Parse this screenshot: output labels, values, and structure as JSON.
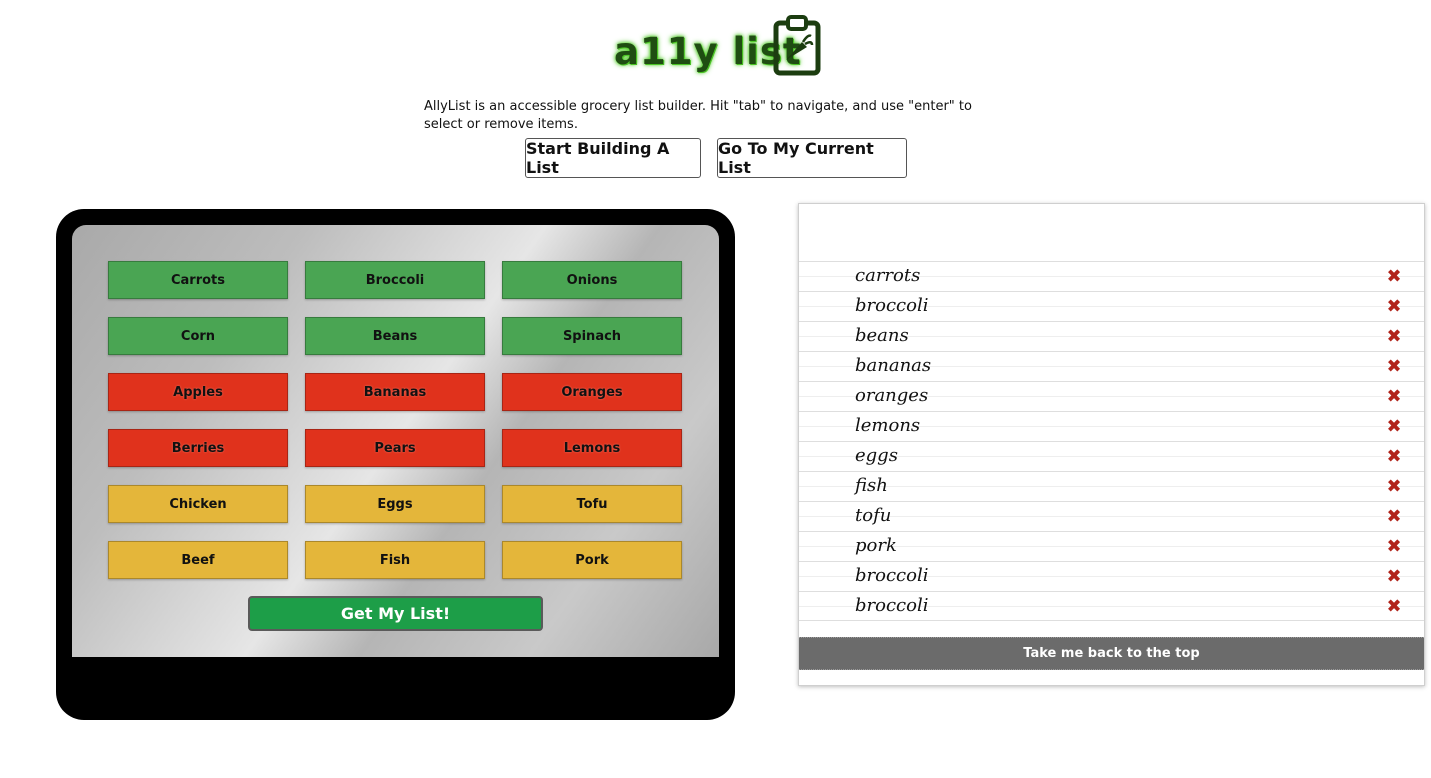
{
  "header": {
    "logo_text": "a11y list",
    "logo_icon": "clipboard-carrot-icon",
    "intro": "AllyList is an accessible grocery list builder. Hit \"tab\" to navigate, and use \"enter\" to select or remove items.",
    "start_label": "Start Building A List",
    "current_label": "Go To My Current List"
  },
  "builder": {
    "rows": [
      [
        {
          "label": "Carrots",
          "group": "veg"
        },
        {
          "label": "Broccoli",
          "group": "veg"
        },
        {
          "label": "Onions",
          "group": "veg"
        }
      ],
      [
        {
          "label": "Corn",
          "group": "veg"
        },
        {
          "label": "Beans",
          "group": "veg"
        },
        {
          "label": "Spinach",
          "group": "veg"
        }
      ],
      [
        {
          "label": "Apples",
          "group": "fruit"
        },
        {
          "label": "Bananas",
          "group": "fruit"
        },
        {
          "label": "Oranges",
          "group": "fruit"
        }
      ],
      [
        {
          "label": "Berries",
          "group": "fruit"
        },
        {
          "label": "Pears",
          "group": "fruit"
        },
        {
          "label": "Lemons",
          "group": "fruit"
        }
      ],
      [
        {
          "label": "Chicken",
          "group": "protein"
        },
        {
          "label": "Eggs",
          "group": "protein"
        },
        {
          "label": "Tofu",
          "group": "protein"
        }
      ],
      [
        {
          "label": "Beef",
          "group": "protein"
        },
        {
          "label": "Fish",
          "group": "protein"
        },
        {
          "label": "Pork",
          "group": "protein"
        }
      ]
    ],
    "get_list_label": "Get My List!"
  },
  "list": {
    "items": [
      "carrots",
      "broccoli",
      "beans",
      "bananas",
      "oranges",
      "lemons",
      "eggs",
      "fish",
      "tofu",
      "pork",
      "broccoli",
      "broccoli"
    ],
    "remove_icon": "close-x-icon",
    "back_top_label": "Take me back to the top"
  },
  "colors": {
    "veg": "#4aa553",
    "fruit": "#e0321c",
    "protein": "#e4b63a",
    "get_list": "#1d9e48",
    "remove": "#b1231a",
    "back_top": "#6b6b6b"
  }
}
